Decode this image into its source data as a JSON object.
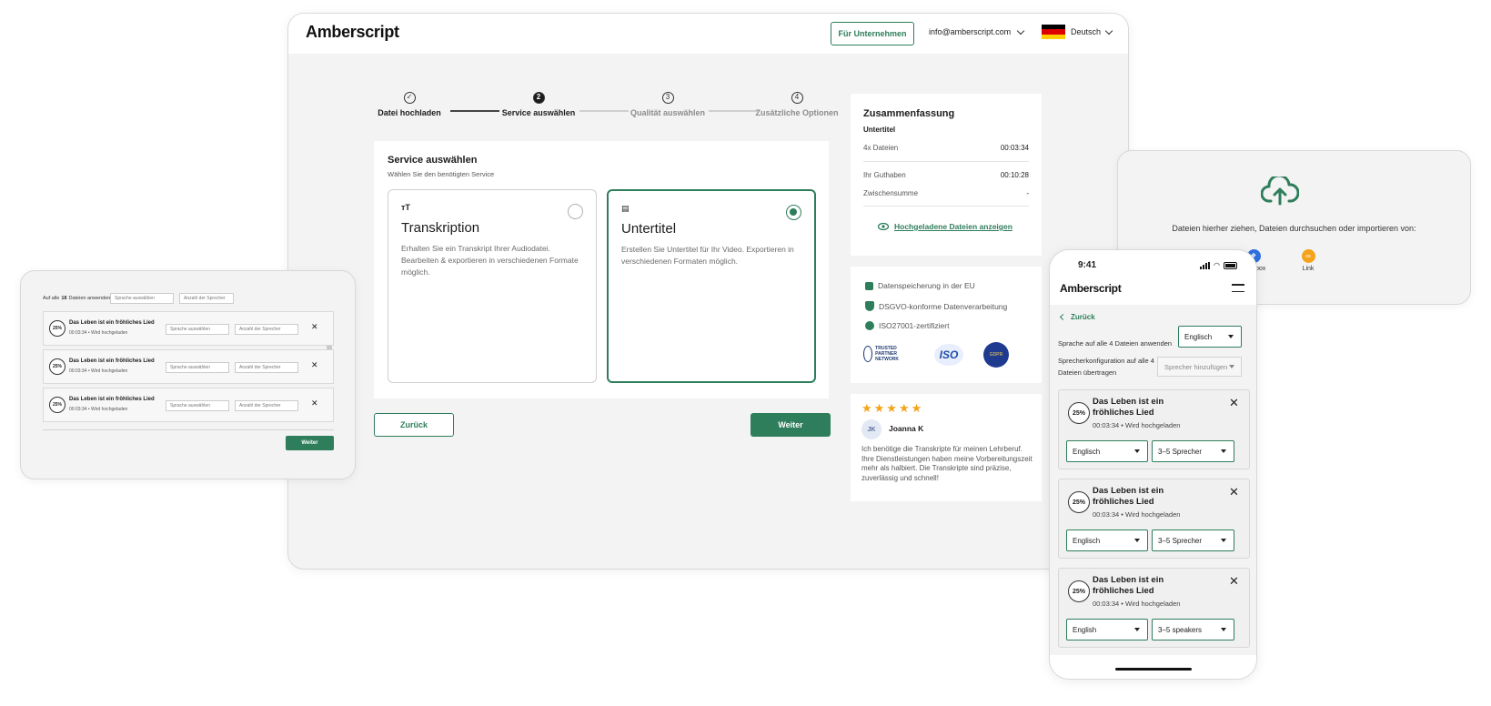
{
  "desktop": {
    "logo": "Amberscript",
    "business_button": "Für Unternehmen",
    "account_email": "info@amberscript.com",
    "language": "Deutsch",
    "steps": [
      {
        "num": "✓",
        "label": "Datei hochladen"
      },
      {
        "num": "2",
        "label": "Service auswählen"
      },
      {
        "num": "3",
        "label": "Qualität auswählen"
      },
      {
        "num": "4",
        "label": "Zusätzliche Optionen"
      }
    ],
    "service": {
      "title": "Service auswählen",
      "subtitle": "Wählen Sie den benötigten Service",
      "options": [
        {
          "icon": "тT",
          "title": "Transkription",
          "desc": "Erhalten Sie ein Transkript Ihrer Audiodatei. Bearbeiten & exportieren in verschiedenen Formate möglich."
        },
        {
          "icon": "▤",
          "title": "Untertitel",
          "desc": "Erstellen Sie Untertitel für Ihr Video. Exportieren in verschiedenen Formaten möglich."
        }
      ]
    },
    "back_button": "Zurück",
    "next_button": "Weiter",
    "summary": {
      "title": "Zusammenfassung",
      "subtitle": "Untertitel",
      "rows": [
        {
          "label": "4x Dateien",
          "value": "00:03:34"
        },
        {
          "label": "Ihr Guthaben",
          "value": "00:10:28"
        },
        {
          "label": "Zwischensumme",
          "value": "-"
        }
      ],
      "link": "Hochgeladene Dateien anzeigen"
    },
    "trust": {
      "items": [
        "Datenspeicherung in der EU",
        "DSGVO-konforme Datenverarbeitung",
        "ISO27001-zertifiziert"
      ],
      "badges": [
        "TRUSTED PARTNER NETWORK",
        "ISO",
        "GDPR"
      ]
    },
    "review": {
      "stars": "★★★★★",
      "initials": "JK",
      "name": "Joanna K",
      "text": "Ich benötige die Transkripte für meinen Lehrberuf. Ihre Dienstleistungen haben meine Vorbereitungszeit mehr als halbiert. Die Transkripte sind präzise, zuverlässig und schnell!"
    }
  },
  "tablet": {
    "apply_prefix": "Auf alle",
    "apply_count": "18",
    "apply_suffix": "Dateien anwenden",
    "lang_placeholder": "Sprache auswählen",
    "speaker_placeholder": "Anzahl der Sprecher",
    "rows": [
      {
        "progress": "25%",
        "title": "Das Leben ist ein fröhliches Lied",
        "meta": "00:03:34 • Wird hochgeladen"
      },
      {
        "progress": "25%",
        "title": "Das Leben ist ein fröhliches Lied",
        "meta": "00:03:34 • Wird hochgeladen"
      },
      {
        "progress": "25%",
        "title": "Das Leben ist ein fröhliches Lied",
        "meta": "00:03:34 • Wird hochgeladen"
      }
    ],
    "next_button": "Weiter"
  },
  "upload": {
    "text": "Dateien hierher ziehen, Dateien durchsuchen oder importieren von:",
    "sources": [
      "Dropbox",
      "Link"
    ]
  },
  "phone": {
    "time": "9:41",
    "logo": "Amberscript",
    "back": "Zurück",
    "apply_lang_label": "Sprache auf alle 4 Dateien anwenden",
    "apply_lang_value": "Englisch",
    "speaker_label": "Sprecherkonfiguration auf alle 4 Dateien übertragen",
    "speaker_placeholder": "Sprecher hinzufügen",
    "cards": [
      {
        "progress": "25%",
        "title": "Das Leben ist ein fröhliches Lied",
        "meta": "00:03:34 • Wird hochgeladen",
        "lang": "Englisch",
        "speakers": "3–5 Sprecher"
      },
      {
        "progress": "25%",
        "title": "Das Leben ist ein fröhliches Lied",
        "meta": "00:03:34 • Wird hochgeladen",
        "lang": "Englisch",
        "speakers": "3–5 Sprecher"
      },
      {
        "progress": "25%",
        "title": "Das Leben ist ein fröhliches Lied",
        "meta": "00:03:34 • Wird hochgeladen",
        "lang": "English",
        "speakers": "3–5 speakers"
      }
    ]
  },
  "colors": {
    "brand": "#2e7d5b",
    "star": "#f4a31a",
    "dropbox": "#2f6fe0",
    "link": "#f4a31a"
  }
}
